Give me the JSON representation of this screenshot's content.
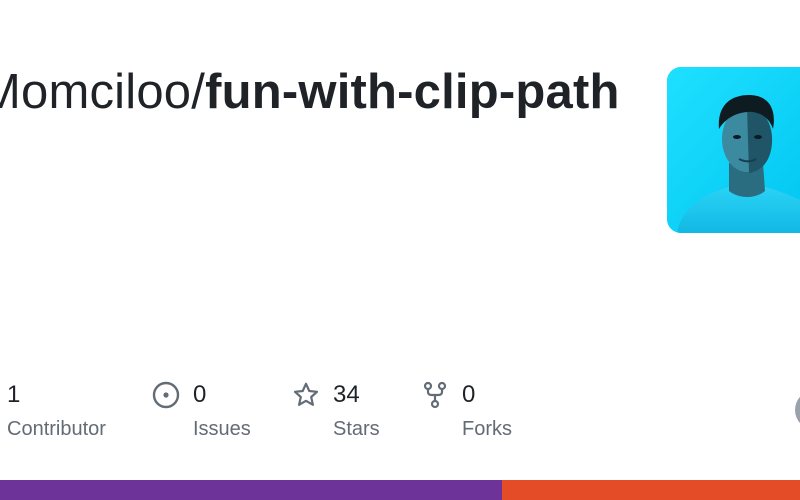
{
  "repo": {
    "owner": "Momciloo/",
    "name": "fun-with-clip-path"
  },
  "avatar": {
    "description": "owner avatar",
    "background": "#14d7ff"
  },
  "stats": [
    {
      "value": "1",
      "label": "Contributor",
      "icon": "people-icon"
    },
    {
      "value": "0",
      "label": "Issues",
      "icon": "issue-opened-icon"
    },
    {
      "value": "34",
      "label": "Stars",
      "icon": "star-icon"
    },
    {
      "value": "0",
      "label": "Forks",
      "icon": "repo-forked-icon"
    }
  ],
  "language_bar": {
    "segments": [
      {
        "color": "#6e3399",
        "fraction": 0.627
      },
      {
        "color": "#e34c26",
        "fraction": 0.373
      }
    ]
  },
  "colors": {
    "text": "#1f2328",
    "muted": "#636c76",
    "icon": "#636c76"
  }
}
